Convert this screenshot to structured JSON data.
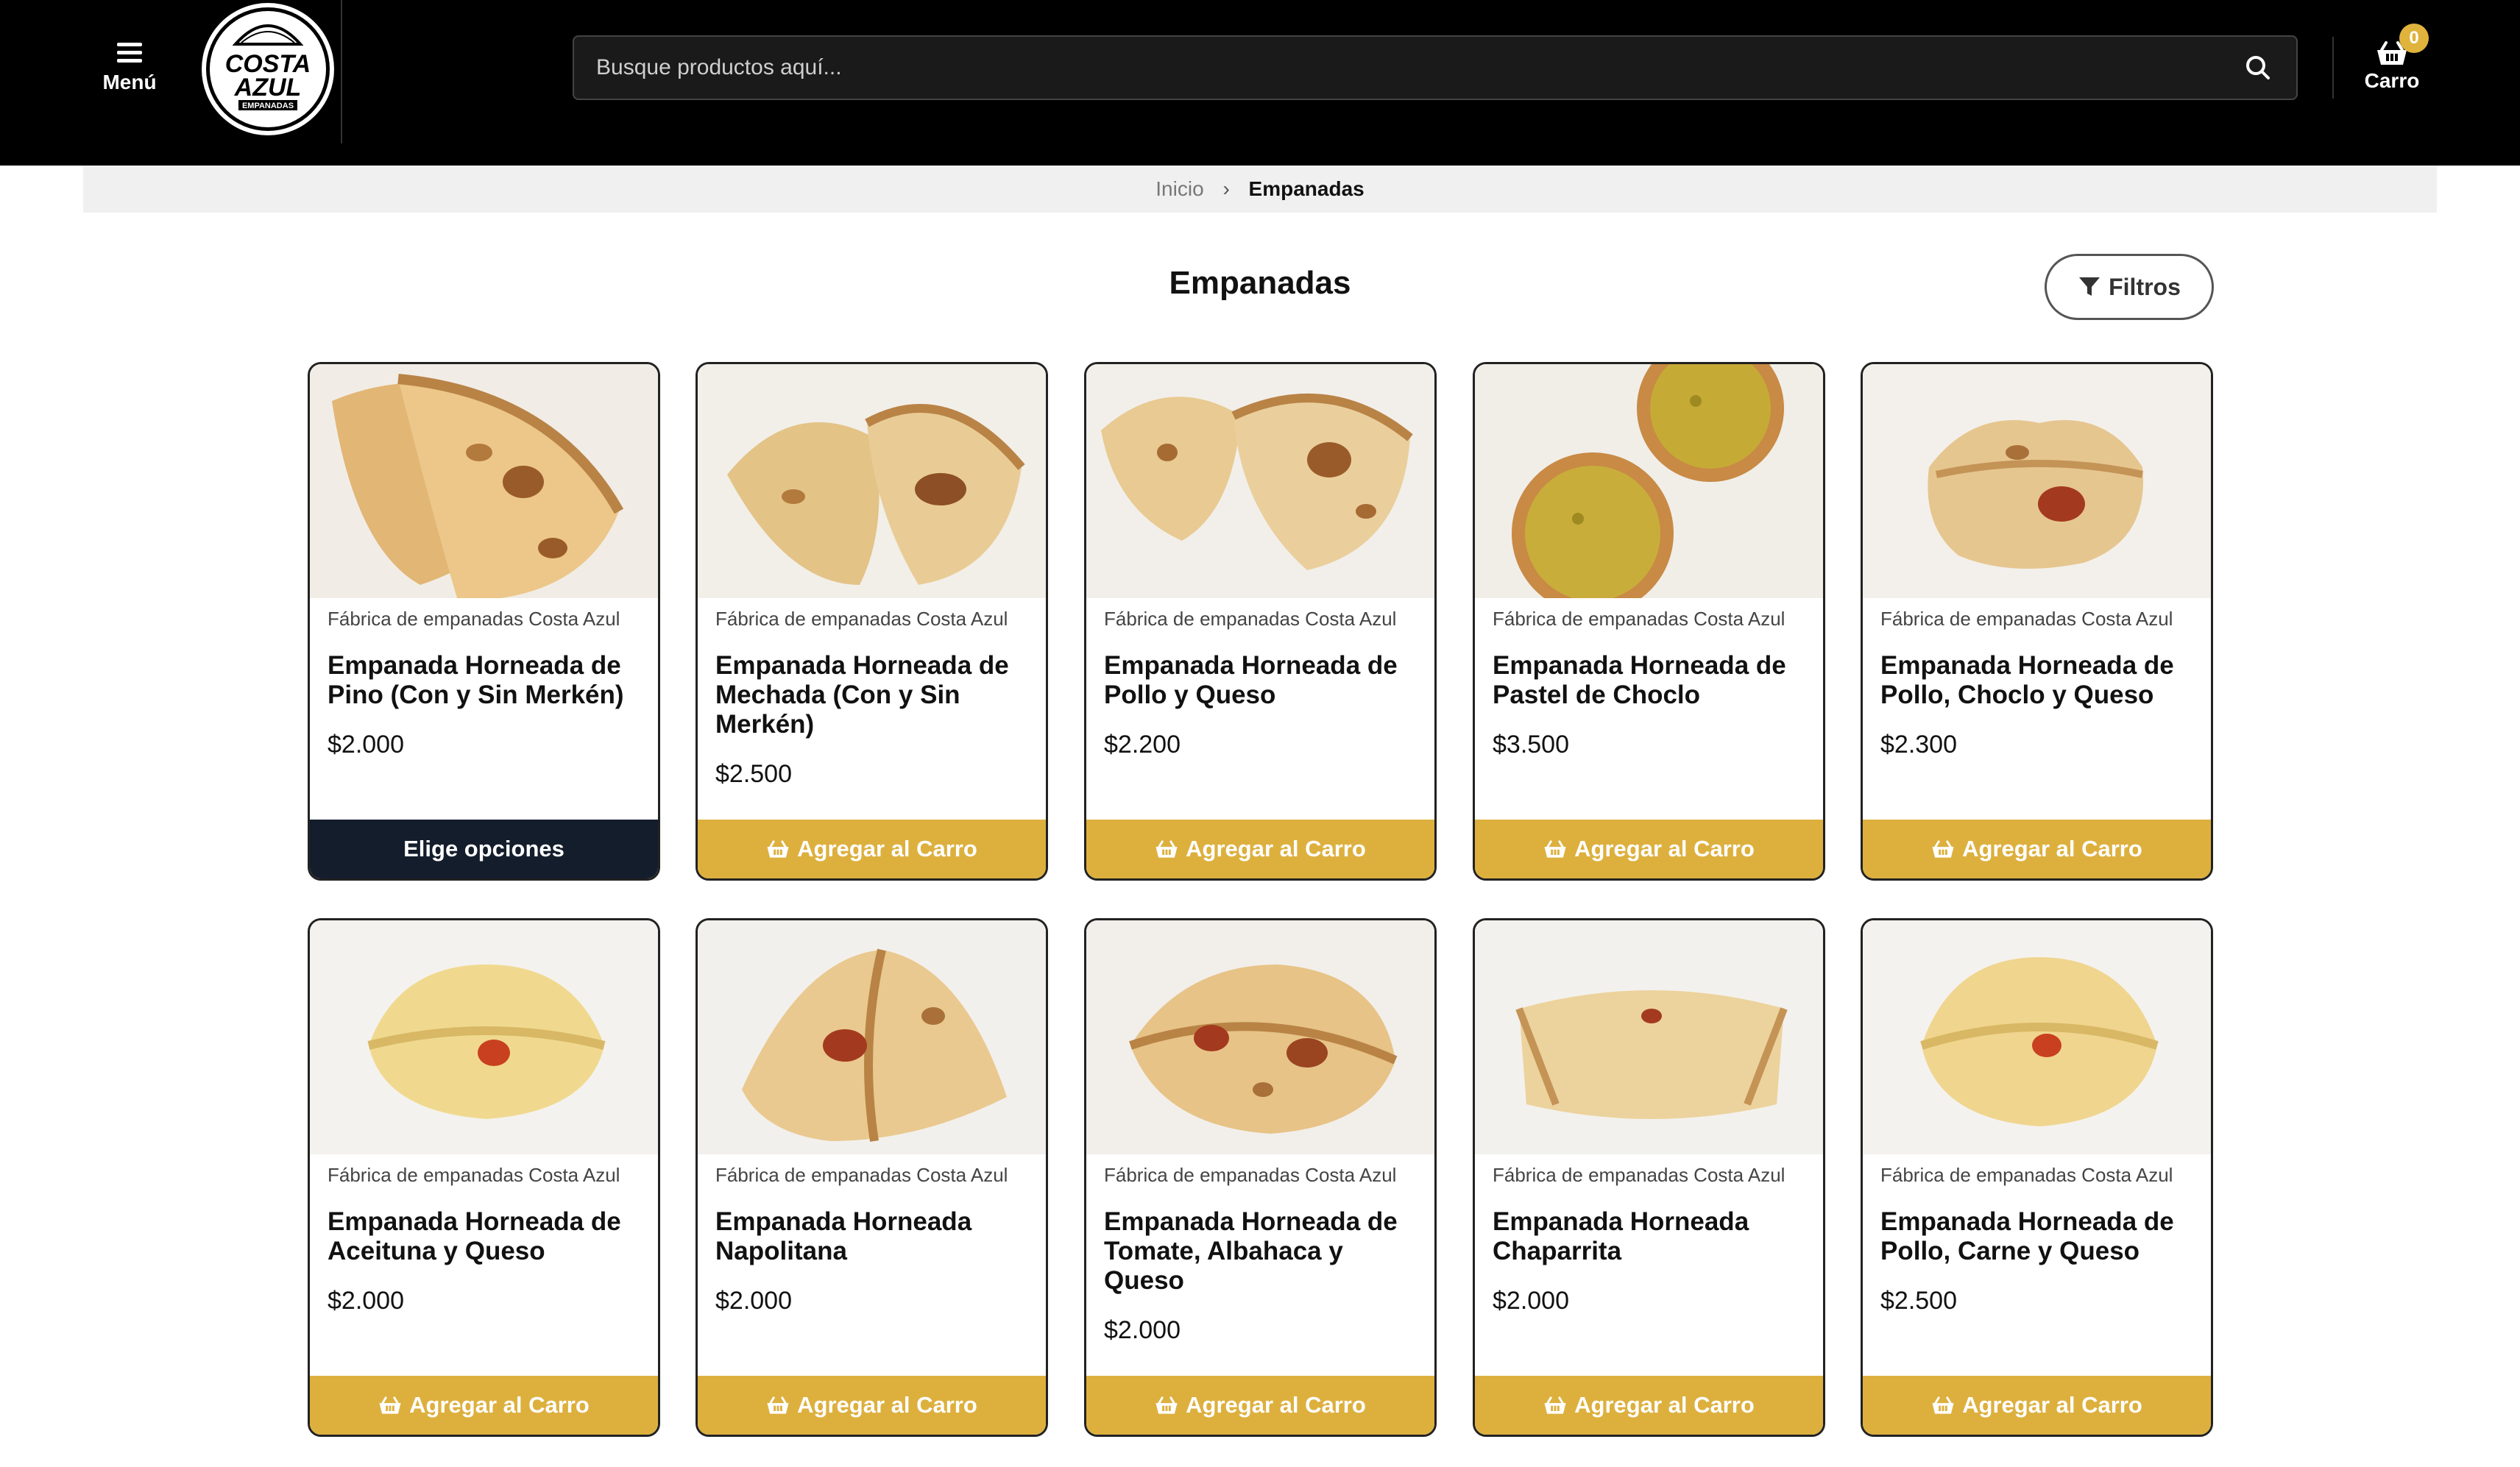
{
  "header": {
    "menu_label": "Menú",
    "logo_text": "COSTA AZUL",
    "logo_sub": "EMPANADAS",
    "search_placeholder": "Busque productos aquí...",
    "cart_label": "Carro",
    "cart_count": "0"
  },
  "breadcrumb": {
    "home": "Inicio",
    "current": "Empanadas"
  },
  "page": {
    "title": "Empanadas",
    "filter_label": "Filtros"
  },
  "products": [
    {
      "brand": "Fábrica de empanadas Costa Azul",
      "name": "Empanada Horneada de Pino (Con y Sin Merkén)",
      "price": "$2.000",
      "button": "Elige opciones"
    },
    {
      "brand": "Fábrica de empanadas Costa Azul",
      "name": "Empanada Horneada de Mechada (Con y Sin Merkén)",
      "price": "$2.500",
      "button": "Agregar al Carro"
    },
    {
      "brand": "Fábrica de empanadas Costa Azul",
      "name": "Empanada Horneada de Pollo y Queso",
      "price": "$2.200",
      "button": "Agregar al Carro"
    },
    {
      "brand": "Fábrica de empanadas Costa Azul",
      "name": "Empanada Horneada de Pastel de Choclo",
      "price": "$3.500",
      "button": "Agregar al Carro"
    },
    {
      "brand": "Fábrica de empanadas Costa Azul",
      "name": "Empanada Horneada de Pollo, Choclo y Queso",
      "price": "$2.300",
      "button": "Agregar al Carro"
    },
    {
      "brand": "Fábrica de empanadas Costa Azul",
      "name": "Empanada Horneada de Aceituna y Queso",
      "price": "$2.000",
      "button": "Agregar al Carro"
    },
    {
      "brand": "Fábrica de empanadas Costa Azul",
      "name": "Empanada Horneada Napolitana",
      "price": "$2.000",
      "button": "Agregar al Carro"
    },
    {
      "brand": "Fábrica de empanadas Costa Azul",
      "name": "Empanada Horneada de Tomate, Albahaca y Queso",
      "price": "$2.000",
      "button": "Agregar al Carro"
    },
    {
      "brand": "Fábrica de empanadas Costa Azul",
      "name": "Empanada Horneada Chaparrita",
      "price": "$2.000",
      "button": "Agregar al Carro"
    },
    {
      "brand": "Fábrica de empanadas Costa Azul",
      "name": "Empanada Horneada de Pollo, Carne y Queso",
      "price": "$2.500",
      "button": "Agregar al Carro"
    }
  ],
  "colors": {
    "accent": "#ddb03e",
    "dark_button": "#141d2b",
    "header_bg": "#000000"
  }
}
